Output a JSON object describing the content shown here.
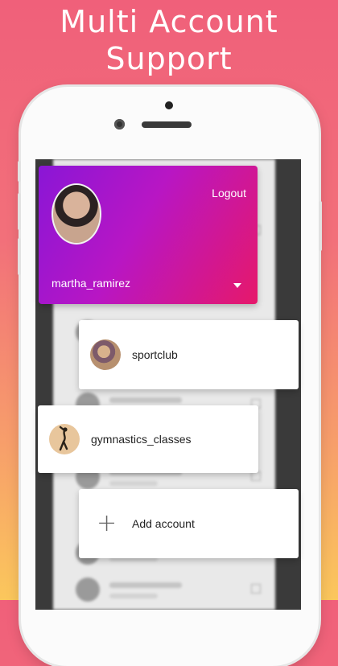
{
  "headline": {
    "line1": "Multi Account",
    "line2": "Support"
  },
  "drawer": {
    "logout_label": "Logout",
    "current_user": "martha_ramirez"
  },
  "accounts": [
    {
      "label": "sportclub",
      "icon": "sportclub-avatar"
    },
    {
      "label": "gymnastics_classes",
      "icon": "gymnastics-avatar"
    }
  ],
  "add_account": {
    "label": "Add account",
    "icon": "plus-icon"
  },
  "colors": {
    "background_top": "#f0607a",
    "background_bottom": "#fbc75c",
    "drawer_gradient_start": "#8a16d6",
    "drawer_gradient_end": "#e6186a"
  }
}
